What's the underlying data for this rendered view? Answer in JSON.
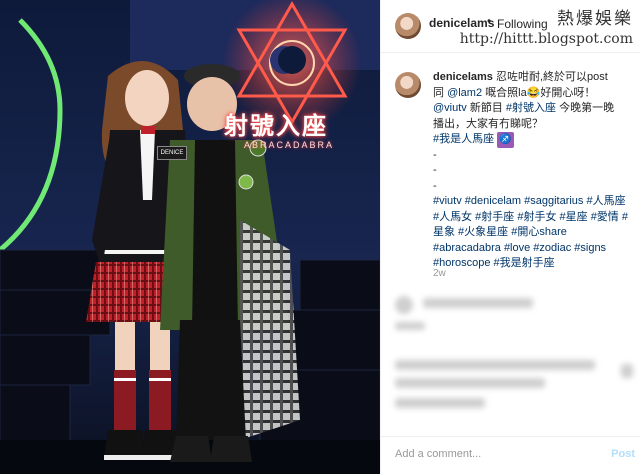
{
  "photo": {
    "sign_title": "射號入座",
    "sign_subtitle": "ABRACADABRA",
    "name_tag": "DENICE"
  },
  "header": {
    "username": "denicelams",
    "separator": "•",
    "follow_label": "Following"
  },
  "watermark": {
    "line1": "熱爆娛樂",
    "line2": "http://hittt.blogspot.com"
  },
  "caption": {
    "username": "denicelams",
    "line1": "忍咗咁耐,終於可以post",
    "line2_pre": "同 ",
    "line2_mention": "@lam2",
    "line2_post": " 嘅合照la😂好開心呀！",
    "line3_mention": "@viutv",
    "line3_text": " 新節目 ",
    "line3_tag": "#射號入座",
    "line3_post": " 今晚第一晚",
    "line4": "播出，大家有冇睇呢？",
    "hashtag_main": "#我是人馬座",
    "sign_emoji": "♐",
    "dash": "-",
    "hashtags": "#viutv #denicelam #saggitarius #人馬座 #人馬女 #射手座 #射手女 #星座 #愛情 #星象 #火象星座 #開心share #abracadabra #love #zodiac #signs #horoscope #我是射手座"
  },
  "meta": {
    "age": "2w"
  },
  "comment_box": {
    "placeholder": "Add a comment...",
    "post_label": "Post"
  },
  "colors": {
    "link": "#003569",
    "post_disabled": "#b2dffc",
    "text": "#262626"
  }
}
